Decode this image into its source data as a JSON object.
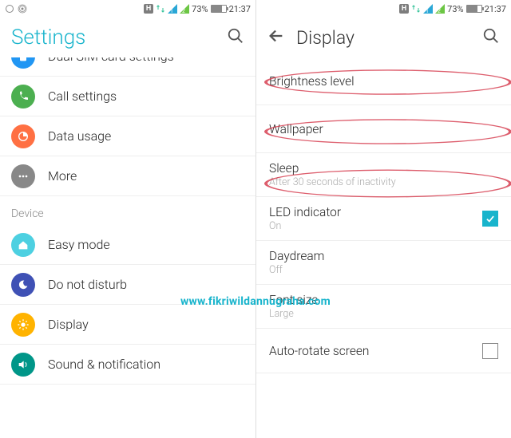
{
  "statusbar": {
    "network_badge": "H",
    "battery_pct": "73%",
    "time": "21:37"
  },
  "left": {
    "title": "Settings",
    "rows": {
      "dualsim": "Dual SIM card settings",
      "call": "Call settings",
      "data": "Data usage",
      "more": "More",
      "section_device": "Device",
      "easy": "Easy mode",
      "dnd": "Do not disturb",
      "display": "Display",
      "sound": "Sound & notification"
    }
  },
  "right": {
    "title": "Display",
    "rows": {
      "brightness": "Brightness level",
      "wallpaper": "Wallpaper",
      "sleep": "Sleep",
      "sleep_sub": "After 30 seconds of inactivity",
      "led": "LED indicator",
      "led_sub": "On",
      "daydream": "Daydream",
      "daydream_sub": "Off",
      "font": "Font size",
      "font_sub": "Large",
      "autorotate": "Auto-rotate screen"
    }
  },
  "watermark": "www.fikriwildannugraha.com"
}
